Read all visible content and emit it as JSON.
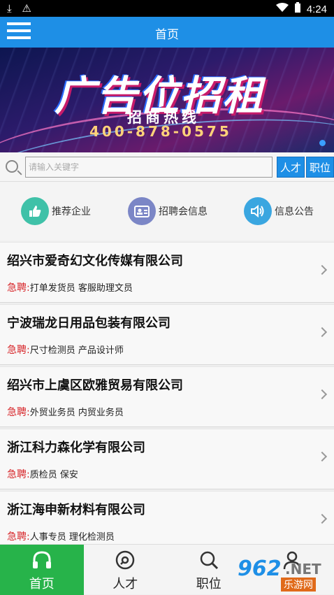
{
  "status_bar": {
    "time": "4:24"
  },
  "app_bar": {
    "title": "首页"
  },
  "banner": {
    "headline": "广告位招租",
    "subtitle": "招商热线",
    "phone": "400-878-0575"
  },
  "search": {
    "placeholder": "请输入关键字",
    "value": "",
    "buttons": [
      "人才",
      "职位"
    ]
  },
  "quick_links": [
    {
      "label": "推荐企业",
      "icon": "thumbs-up-icon",
      "color": "#3fc1a8"
    },
    {
      "label": "招聘会信息",
      "icon": "id-card-icon",
      "color": "#7b86c6"
    },
    {
      "label": "信息公告",
      "icon": "speaker-icon",
      "color": "#3aa6e0"
    }
  ],
  "companies": [
    {
      "name": "绍兴市爱奇幻文化传媒有限公司",
      "urgent_label": "急聘:",
      "jobs": "打单发货员 客服助理文员"
    },
    {
      "name": "宁波瑞龙日用品包装有限公司",
      "urgent_label": "急聘:",
      "jobs": "尺寸检测员 产品设计师"
    },
    {
      "name": "绍兴市上虞区欧雅贸易有限公司",
      "urgent_label": "急聘:",
      "jobs": "外贸业务员 内贸业务员"
    },
    {
      "name": "浙江科力森化学有限公司",
      "urgent_label": "急聘:",
      "jobs": "质检员 保安"
    },
    {
      "name": "浙江海申新材料有限公司",
      "urgent_label": "急聘:",
      "jobs": "人事专员 理化检测员"
    }
  ],
  "tabs": [
    {
      "label": "首页",
      "icon": "headphones-icon",
      "active": true
    },
    {
      "label": "人才",
      "icon": "disc-icon",
      "active": false
    },
    {
      "label": "职位",
      "icon": "search-icon",
      "active": false
    },
    {
      "label": "",
      "icon": "user-icon",
      "active": false
    }
  ],
  "watermark": {
    "number": "962",
    "suffix": ".NET",
    "text": "乐游网"
  },
  "colors": {
    "primary": "#1e8fe6",
    "active_tab": "#27b34a",
    "urgent": "#d7262a"
  }
}
